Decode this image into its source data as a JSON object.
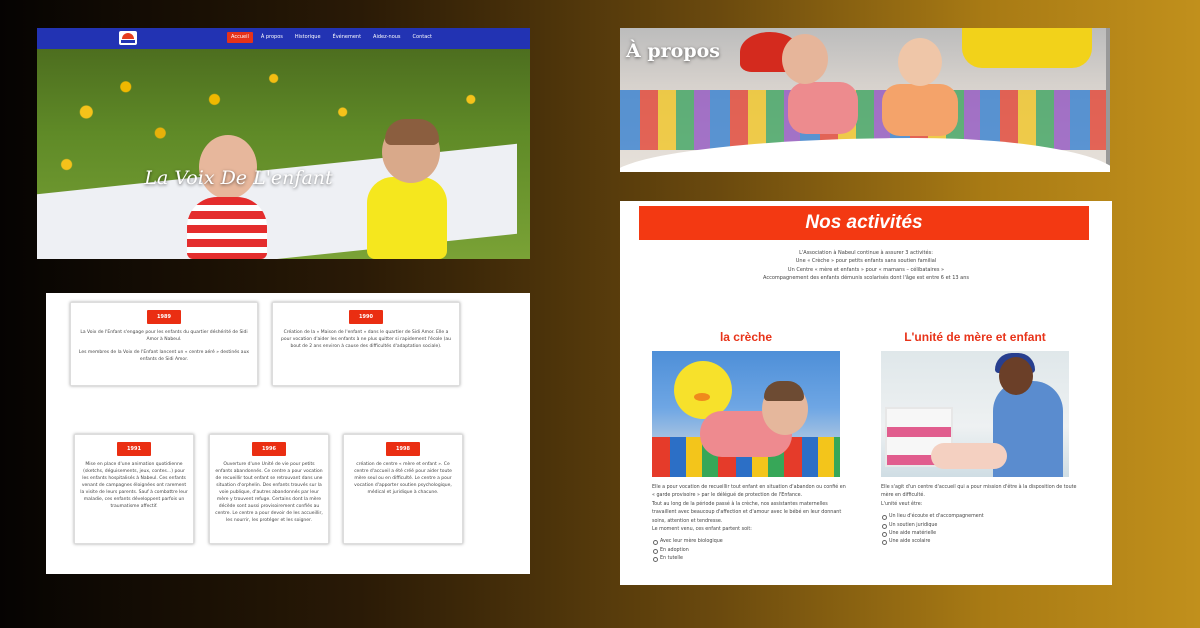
{
  "hero": {
    "menu": [
      "Accueil",
      "À propos",
      "Historique",
      "Événement",
      "Aidez-nous",
      "Contact"
    ],
    "title": "La Voix De L'enfant"
  },
  "apropos": {
    "title": "À propos"
  },
  "timeline": {
    "cards": [
      {
        "year": "1989",
        "paragraphs": [
          "La Voix de l'Enfant s'engage pour les enfants du quartier déshérité de Sidi Amor à Nabeul.",
          "Les membres de la Voix de l'Enfant lancent un « centre aéré » destinés aux enfants de Sidi Amor."
        ]
      },
      {
        "year": "1990",
        "paragraphs": [
          "Création de la « Maison de l'enfant » dans le quartier de Sidi Amor. Elle a pour vocation d'aider les enfants à ne plus quitter si rapidement l'école (au bout de 2 ans environ à cause des difficultés d'adaptation sociale)."
        ]
      },
      {
        "year": "1991",
        "paragraphs": [
          "Mise en place d'une animation quotidienne (sketchs, déguisements, jeux, contes…) pour les enfants hospitalisés à Nabeul. Ces enfants venant de campagnes éloignées ont rarement la visite de leurs parents. Sauf à combattre leur maladie, ces enfants développent parfois un traumatisme affectif."
        ]
      },
      {
        "year": "1996",
        "paragraphs": [
          "Ouverture d'une Unité de vie pour petits enfants abandonnés. Ce centre a pour vocation de recueillir tout enfant se retrouvant dans une situation d'orphelin. Des enfants trouvés sur la voie publique, d'autres abandonnés par leur mère y trouvent refuge. Certains dont la mère décède sont aussi provisoirement confiés au centre. Le centre a pour devoir de les accueillir, les nourrir, les protéger et les soigner."
        ]
      },
      {
        "year": "1998",
        "paragraphs": [
          "création de centre « mère et enfant ». Ce centre d'accueil a été créé pour aider toute mère seul ou en difficulté. Le centre a pour vocation d'apporter soutien psychologique, médical et juridique à chacune."
        ]
      }
    ]
  },
  "activites": {
    "title": "Nos activités",
    "intro": [
      "L'Association à Nabeul continue à assurer 3 activités:",
      "Une « Crèche » pour petits enfants sans soutien familial",
      "Un Centre « mère et enfants » pour « mamans – célibataires »",
      "Accompagnement des enfants démunis scolarisés dont l'âge est entre 6 et 13 ans"
    ],
    "creche": {
      "title": "la crèche",
      "paragraphs": [
        "Elle a pour vocation de recueillir tout enfant en situation d'abandon ou confié en « garde provisoire » par le délégué de protection de l'Enfance.",
        "Tout au long de la période passé à la crèche, nos assistantes maternelles travaillent avec beaucoup d'affection et d'amour avec le bébé en leur donnant soins, attention et tendresse.",
        "Le moment venu, ces enfant partent soit:"
      ],
      "list": [
        "Avec leur mère biologique",
        "En adoption",
        "En tutelle"
      ]
    },
    "mere": {
      "title": "L'unité de mère et enfant",
      "paragraphs": [
        "Elle s'agit d'un centre d'accueil qui a pour mission d'être à la disposition de toute mère en difficulté.",
        "L'unité veut être:"
      ],
      "list": [
        "Un lieu d'écoute et d'accompagnement",
        "Un soutien juridique",
        "Une aide matérielle",
        "Une aide scolaire"
      ]
    }
  }
}
